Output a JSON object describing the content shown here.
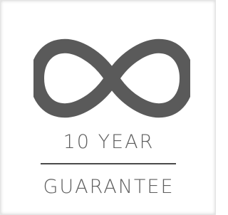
{
  "badge": {
    "line1": "10 YEAR",
    "line2": "GUARANTEE",
    "icon": "infinity-icon",
    "colors": {
      "icon": "#5a5a5a",
      "text": "#5e5e5e",
      "divider": "#4b4b4b",
      "background": "#ffffff"
    }
  }
}
